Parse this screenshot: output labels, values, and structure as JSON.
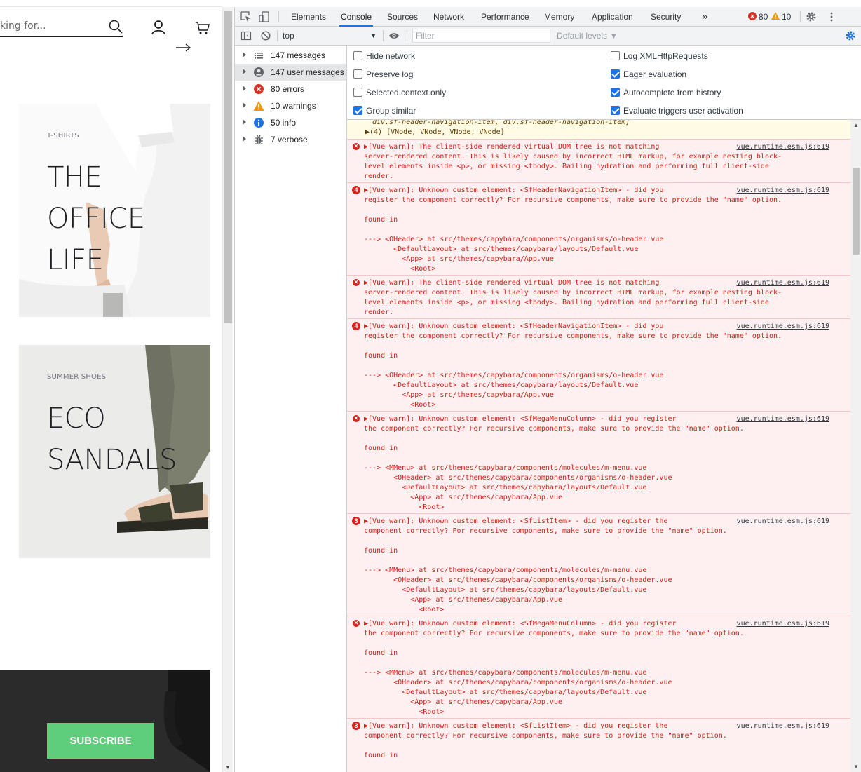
{
  "site": {
    "search_text": "king for...",
    "cards": [
      {
        "subtitle": "T-SHIRTS",
        "title_lines": [
          "THE",
          "OFFICE",
          "LIFE"
        ]
      },
      {
        "subtitle": "SUMMER SHOES",
        "title_lines": [
          "ECO",
          "SANDALS"
        ]
      }
    ],
    "subscribe_label": "SUBSCRIBE",
    "accent": "#5ece7b"
  },
  "devtools": {
    "tabs": [
      "Elements",
      "Console",
      "Sources",
      "Network",
      "Performance",
      "Memory",
      "Application",
      "Security"
    ],
    "active_tab": "Console",
    "more_tabs": "»",
    "error_count": "80",
    "warning_count": "10",
    "toolbar": {
      "context": "top",
      "filter_placeholder": "Filter",
      "levels": "Default levels ▼"
    },
    "sidebar": [
      {
        "icon": "list-icon",
        "label": "147 messages"
      },
      {
        "icon": "user-icon",
        "label": "147 user messages"
      },
      {
        "icon": "error-icon",
        "label": "80 errors"
      },
      {
        "icon": "warning-icon",
        "label": "10 warnings"
      },
      {
        "icon": "info-icon",
        "label": "50 info"
      },
      {
        "icon": "bug-icon",
        "label": "7 verbose"
      }
    ],
    "settings": {
      "left": [
        {
          "label": "Hide network",
          "checked": false
        },
        {
          "label": "Preserve log",
          "checked": false
        },
        {
          "label": "Selected context only",
          "checked": false
        },
        {
          "label": "Group similar",
          "checked": true
        }
      ],
      "right": [
        {
          "label": "Log XMLHttpRequests",
          "checked": false
        },
        {
          "label": "Eager evaluation",
          "checked": true
        },
        {
          "label": "Autocomplete from history",
          "checked": true
        },
        {
          "label": "Evaluate triggers user activation",
          "checked": true
        }
      ]
    },
    "warn_fragment": {
      "line1": "div.sf-header-navigation-item, div.sf-header-navigation-item]",
      "line2": "▶(4) [VNode, VNode, VNode, VNode]"
    },
    "messages": [
      {
        "count": "",
        "source": "vue.runtime.esm.js:619",
        "text": "▶[Vue warn]: The client-side rendered virtual DOM tree is not matching\nserver-rendered content. This is likely caused by incorrect HTML markup, for example nesting block-\nlevel elements inside <p>, or missing <tbody>. Bailing hydration and performing full client-side\nrender."
      },
      {
        "count": "4",
        "source": "vue.runtime.esm.js:619",
        "text": "▶[Vue warn]: Unknown custom element: <SfHeaderNavigationItem> - did you\nregister the component correctly? For recursive components, make sure to provide the \"name\" option.\n\nfound in\n\n---> <OHeader> at src/themes/capybara/components/organisms/o-header.vue\n       <DefaultLayout> at src/themes/capybara/layouts/Default.vue\n         <App> at src/themes/capybara/App.vue\n           <Root>"
      },
      {
        "count": "",
        "source": "vue.runtime.esm.js:619",
        "text": "▶[Vue warn]: The client-side rendered virtual DOM tree is not matching\nserver-rendered content. This is likely caused by incorrect HTML markup, for example nesting block-\nlevel elements inside <p>, or missing <tbody>. Bailing hydration and performing full client-side\nrender."
      },
      {
        "count": "4",
        "source": "vue.runtime.esm.js:619",
        "text": "▶[Vue warn]: Unknown custom element: <SfHeaderNavigationItem> - did you\nregister the component correctly? For recursive components, make sure to provide the \"name\" option.\n\nfound in\n\n---> <OHeader> at src/themes/capybara/components/organisms/o-header.vue\n       <DefaultLayout> at src/themes/capybara/layouts/Default.vue\n         <App> at src/themes/capybara/App.vue\n           <Root>"
      },
      {
        "count": "",
        "source": "vue.runtime.esm.js:619",
        "text": "▶[Vue warn]: Unknown custom element: <SfMegaMenuColumn> - did you register\nthe component correctly? For recursive components, make sure to provide the \"name\" option.\n\nfound in\n\n---> <MMenu> at src/themes/capybara/components/molecules/m-menu.vue\n       <OHeader> at src/themes/capybara/components/organisms/o-header.vue\n         <DefaultLayout> at src/themes/capybara/layouts/Default.vue\n           <App> at src/themes/capybara/App.vue\n             <Root>"
      },
      {
        "count": "3",
        "source": "vue.runtime.esm.js:619",
        "text": "▶[Vue warn]: Unknown custom element: <SfListItem> - did you register the\ncomponent correctly? For recursive components, make sure to provide the \"name\" option.\n\nfound in\n\n---> <MMenu> at src/themes/capybara/components/molecules/m-menu.vue\n       <OHeader> at src/themes/capybara/components/organisms/o-header.vue\n         <DefaultLayout> at src/themes/capybara/layouts/Default.vue\n           <App> at src/themes/capybara/App.vue\n             <Root>"
      },
      {
        "count": "",
        "source": "vue.runtime.esm.js:619",
        "text": "▶[Vue warn]: Unknown custom element: <SfMegaMenuColumn> - did you register\nthe component correctly? For recursive components, make sure to provide the \"name\" option.\n\nfound in\n\n---> <MMenu> at src/themes/capybara/components/molecules/m-menu.vue\n       <OHeader> at src/themes/capybara/components/organisms/o-header.vue\n         <DefaultLayout> at src/themes/capybara/layouts/Default.vue\n           <App> at src/themes/capybara/App.vue\n             <Root>"
      },
      {
        "count": "3",
        "source": "vue.runtime.esm.js:619",
        "text": "▶[Vue warn]: Unknown custom element: <SfListItem> - did you register the\ncomponent correctly? For recursive components, make sure to provide the \"name\" option.\n\nfound in"
      }
    ]
  }
}
